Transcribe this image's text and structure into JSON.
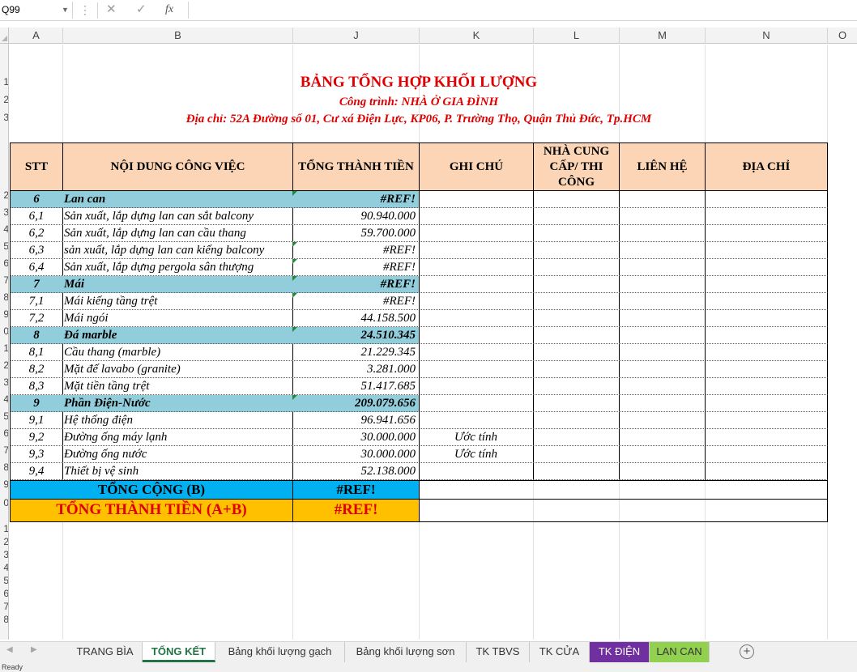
{
  "formula_bar": {
    "name_box": "Q99",
    "cancel_icon": "✕",
    "enter_icon": "✓",
    "fx_label": "fx"
  },
  "columns": [
    "A",
    "B",
    "J",
    "K",
    "L",
    "M",
    "N",
    "O"
  ],
  "row_numbers": [
    "",
    "",
    "1",
    "2",
    "3",
    "",
    "",
    "",
    "",
    "2",
    "3",
    "4",
    "5",
    "6",
    "7",
    "8",
    "9",
    "0",
    "1",
    "2",
    "3",
    "4",
    "5",
    "6",
    "7",
    "8",
    "9",
    "0",
    "1",
    "2",
    "3",
    "4",
    "5",
    "6",
    "7",
    "8"
  ],
  "title": {
    "main": "BẢNG TỔNG HỢP KHỐI LƯỢNG",
    "project": "Công trình: NHÀ Ở GIA ĐÌNH",
    "address": "Địa chỉ: 52A Đường số 01, Cư xá Điện Lực, KP06, P. Trường Thọ, Quận Thủ Đức, Tp.HCM"
  },
  "table": {
    "headers": [
      "STT",
      "NỘI DUNG CÔNG VIỆC",
      "TỔNG THÀNH TIỀN",
      "GHI CHÚ",
      "NHÀ CUNG CẤP/ THI CÔNG",
      "LIÊN HỆ",
      "ĐỊA CHỈ"
    ],
    "rows": [
      {
        "stt": "6",
        "name": "Lan can",
        "amount": "#REF!",
        "note": "",
        "section": true
      },
      {
        "stt": "6,1",
        "name": "Sản xuất, lắp dựng lan can sắt balcony",
        "amount": "90.940.000",
        "note": ""
      },
      {
        "stt": "6,2",
        "name": "Sản xuất, lắp dựng lan can cầu thang",
        "amount": "59.700.000",
        "note": ""
      },
      {
        "stt": "6,3",
        "name": "sản xuất, lắp dựng lan can kiếng balcony",
        "amount": "#REF!",
        "note": ""
      },
      {
        "stt": "6,4",
        "name": "Sản xuất, lắp dựng pergola sân thượng",
        "amount": "#REF!",
        "note": ""
      },
      {
        "stt": "7",
        "name": "Mái",
        "amount": "#REF!",
        "note": "",
        "section": true
      },
      {
        "stt": "7,1",
        "name": "Mái kiếng tầng trệt",
        "amount": "#REF!",
        "note": ""
      },
      {
        "stt": "7,2",
        "name": "Mái ngói",
        "amount": "44.158.500",
        "note": ""
      },
      {
        "stt": "8",
        "name": "Đá marble",
        "amount": "24.510.345",
        "note": "",
        "section": true
      },
      {
        "stt": "8,1",
        "name": "Cầu thang (marble)",
        "amount": "21.229.345",
        "note": ""
      },
      {
        "stt": "8,2",
        "name": "Mặt đế lavabo (granite)",
        "amount": "3.281.000",
        "note": ""
      },
      {
        "stt": "8,3",
        "name": "Mặt tiền tầng trệt",
        "amount": "51.417.685",
        "note": ""
      },
      {
        "stt": "9",
        "name": "Phần Điện-Nước",
        "amount": "209.079.656",
        "note": "",
        "section": true
      },
      {
        "stt": "9,1",
        "name": "Hệ thống điện",
        "amount": "96.941.656",
        "note": ""
      },
      {
        "stt": "9,2",
        "name": "Đường ống máy lạnh",
        "amount": "30.000.000",
        "note": "Ước tính"
      },
      {
        "stt": "9,3",
        "name": "Đường ống nước",
        "amount": "30.000.000",
        "note": "Ước tính"
      },
      {
        "stt": "9,4",
        "name": "Thiết bị vệ sinh",
        "amount": "52.138.000",
        "note": ""
      }
    ],
    "total_b_label": "TỔNG CỘNG (B)",
    "total_b_value": "#REF!",
    "grand_total_label": "TỔNG THÀNH TIỀN (A+B)",
    "grand_total_value": "#REF!"
  },
  "sheet_tabs": [
    {
      "label": "TRANG BÌA",
      "active": false,
      "color": ""
    },
    {
      "label": "TỔNG KẾT",
      "active": true,
      "color": ""
    },
    {
      "label": "Bảng khối lượng gạch",
      "active": false,
      "color": ""
    },
    {
      "label": "Bảng khối lượng sơn",
      "active": false,
      "color": ""
    },
    {
      "label": "TK TBVS",
      "active": false,
      "color": ""
    },
    {
      "label": "TK CỬA",
      "active": false,
      "color": ""
    },
    {
      "label": "TK ĐIỆN",
      "active": false,
      "color": "#7030a0"
    },
    {
      "label": "LAN CAN",
      "active": false,
      "color": "#92d050"
    }
  ],
  "add_sheet_label": "+",
  "status_text": "Ready",
  "colors": {
    "header_fill": "#fbd5b5",
    "section_fill": "#92cddc",
    "total_b_fill": "#00b0f0",
    "grand_fill": "#ffc000",
    "title_red": "#e00000",
    "excel_green": "#217346"
  }
}
